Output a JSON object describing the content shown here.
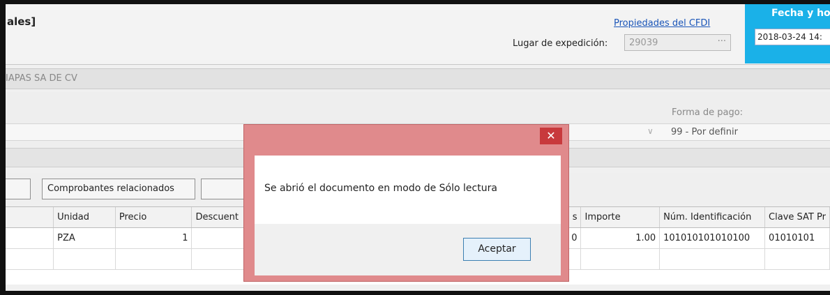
{
  "header": {
    "title_fragment": "ales]",
    "cfdi_link": "Propiedades del CFDI",
    "lugar_label": "Lugar de expedición:",
    "lugar_value": "29039",
    "lugar_dots": "···",
    "fecha_title": "Fecha y hora",
    "fecha_value": "2018-03-24 14:"
  },
  "emisor": {
    "name_fragment": "IAPAS SA DE CV"
  },
  "pago": {
    "label": "Forma de pago:",
    "value": "99 - Por definir",
    "arrow": "∨"
  },
  "buttons": {
    "relacionados": "Comprobantes relacionados"
  },
  "grid": {
    "headers": [
      "",
      "Unidad",
      "Precio",
      "Descuent",
      "",
      "",
      "s",
      "Importe",
      "Núm. Identificación",
      "Clave SAT Pr"
    ],
    "row1": [
      "",
      "PZA",
      "1",
      "",
      "",
      "",
      "0",
      "1.00",
      "101010101010100",
      "01010101"
    ]
  },
  "dialog": {
    "close_glyph": "✕",
    "message": "Se abrió el documento en modo de Sólo lectura",
    "ok_label": "Aceptar"
  },
  "colors": {
    "accent_blue": "#1ab1e8",
    "dialog_frame": "#e08a8c",
    "close_red": "#c8393c",
    "link": "#1a55b8"
  }
}
